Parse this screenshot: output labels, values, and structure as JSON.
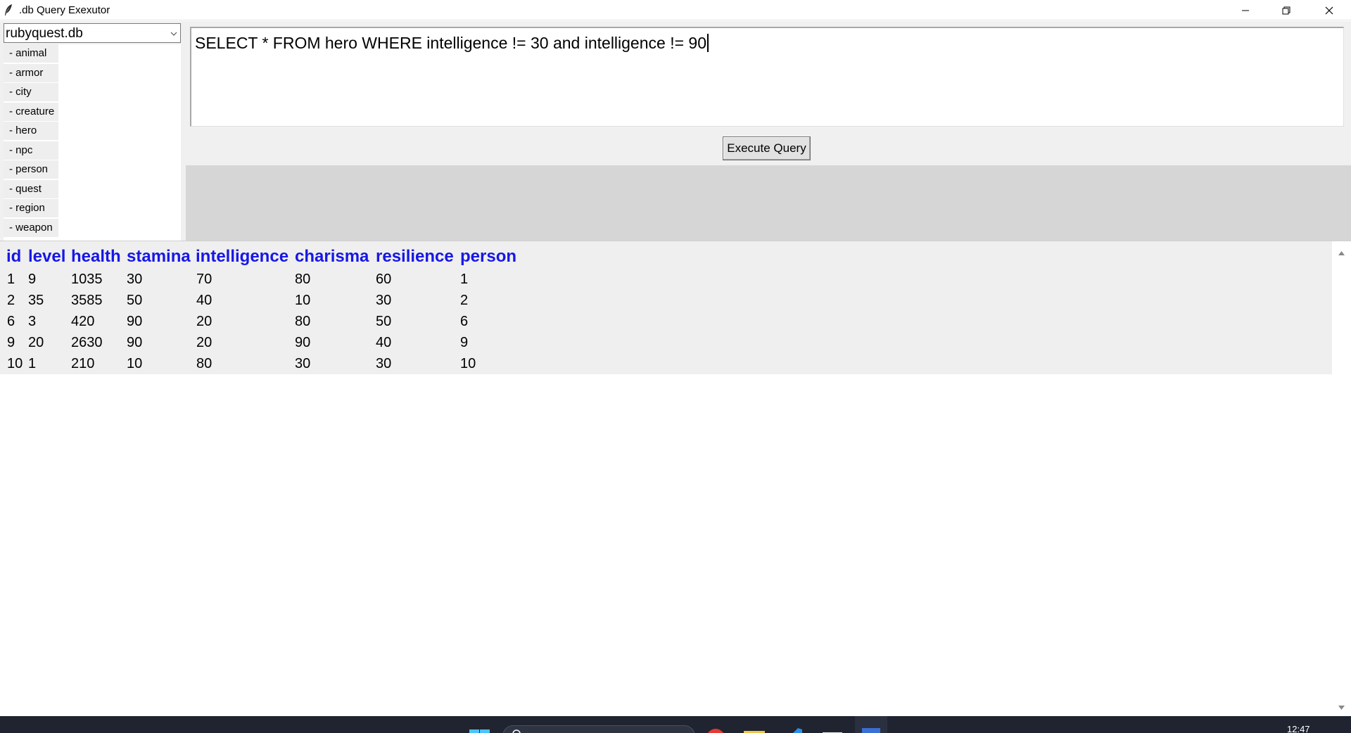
{
  "window": {
    "title": ".db Query Exexutor",
    "controls": [
      "minimize",
      "restore",
      "close"
    ]
  },
  "db_selector": {
    "selected": "rubyquest.db"
  },
  "tables": [
    "- animal",
    "- armor",
    "- city",
    "- creature",
    "- hero",
    "- npc",
    "- person",
    "- quest",
    "- region",
    "- weapon"
  ],
  "query": {
    "text": "SELECT * FROM hero WHERE intelligence != 30 and intelligence != 90",
    "execute_label": "Execute Query"
  },
  "results": {
    "columns": [
      "id",
      "level",
      "health",
      "stamina",
      "intelligence",
      "charisma",
      "resilience",
      "person"
    ],
    "rows": [
      [
        "1",
        "9",
        "1035",
        "30",
        "70",
        "80",
        "60",
        "1"
      ],
      [
        "2",
        "35",
        "3585",
        "50",
        "40",
        "10",
        "30",
        "2"
      ],
      [
        "6",
        "3",
        "420",
        "90",
        "20",
        "80",
        "50",
        "6"
      ],
      [
        "9",
        "20",
        "2630",
        "90",
        "20",
        "90",
        "40",
        "9"
      ],
      [
        "10",
        "1",
        "210",
        "10",
        "80",
        "30",
        "30",
        "10"
      ]
    ]
  },
  "taskbar": {
    "clock": "12:47"
  },
  "colors": {
    "header_text": "#1717e6",
    "panel_bg": "#f0f0f0",
    "query_area_bg": "#d6d6d6",
    "taskbar_bg": "#1f2430"
  }
}
